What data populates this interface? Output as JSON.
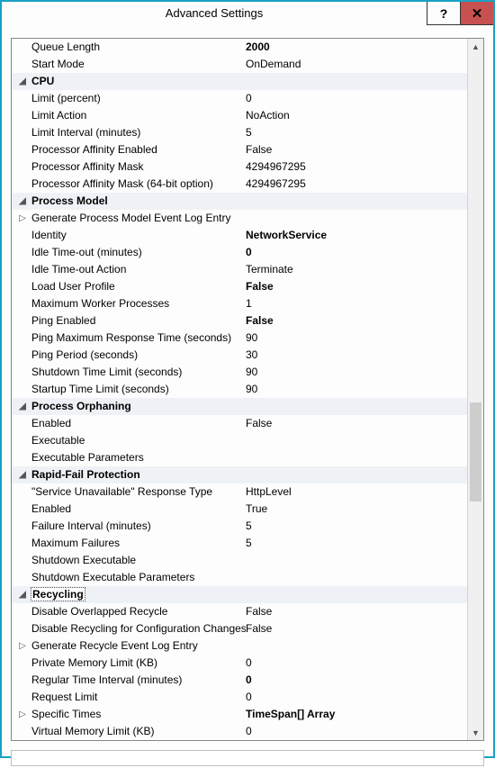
{
  "window": {
    "title": "Advanced Settings"
  },
  "glyph": {
    "expanded": "◢",
    "collapsed": "▷",
    "help": "?",
    "close": "✕",
    "up": "▲",
    "down": "▼"
  },
  "rows": [
    {
      "kind": "prop",
      "label": "Queue Length",
      "value": "2000",
      "boldValue": true
    },
    {
      "kind": "prop",
      "label": "Start Mode",
      "value": "OnDemand"
    },
    {
      "kind": "cat",
      "label": "CPU",
      "expanded": true
    },
    {
      "kind": "prop",
      "label": "Limit (percent)",
      "value": "0"
    },
    {
      "kind": "prop",
      "label": "Limit Action",
      "value": "NoAction"
    },
    {
      "kind": "prop",
      "label": "Limit Interval (minutes)",
      "value": "5"
    },
    {
      "kind": "prop",
      "label": "Processor Affinity Enabled",
      "value": "False"
    },
    {
      "kind": "prop",
      "label": "Processor Affinity Mask",
      "value": "4294967295"
    },
    {
      "kind": "prop",
      "label": "Processor Affinity Mask (64-bit option)",
      "value": "4294967295"
    },
    {
      "kind": "cat",
      "label": "Process Model",
      "expanded": true
    },
    {
      "kind": "sub",
      "label": "Generate Process Model Event Log Entry",
      "value": "",
      "expanded": false
    },
    {
      "kind": "prop",
      "label": "Identity",
      "value": "NetworkService",
      "boldValue": true
    },
    {
      "kind": "prop",
      "label": "Idle Time-out (minutes)",
      "value": "0",
      "boldValue": true
    },
    {
      "kind": "prop",
      "label": "Idle Time-out Action",
      "value": "Terminate"
    },
    {
      "kind": "prop",
      "label": "Load User Profile",
      "value": "False",
      "boldValue": true
    },
    {
      "kind": "prop",
      "label": "Maximum Worker Processes",
      "value": "1"
    },
    {
      "kind": "prop",
      "label": "Ping Enabled",
      "value": "False",
      "boldValue": true
    },
    {
      "kind": "prop",
      "label": "Ping Maximum Response Time (seconds)",
      "value": "90"
    },
    {
      "kind": "prop",
      "label": "Ping Period (seconds)",
      "value": "30"
    },
    {
      "kind": "prop",
      "label": "Shutdown Time Limit (seconds)",
      "value": "90"
    },
    {
      "kind": "prop",
      "label": "Startup Time Limit (seconds)",
      "value": "90"
    },
    {
      "kind": "cat",
      "label": "Process Orphaning",
      "expanded": true
    },
    {
      "kind": "prop",
      "label": "Enabled",
      "value": "False"
    },
    {
      "kind": "prop",
      "label": "Executable",
      "value": ""
    },
    {
      "kind": "prop",
      "label": "Executable Parameters",
      "value": ""
    },
    {
      "kind": "cat",
      "label": "Rapid-Fail Protection",
      "expanded": true
    },
    {
      "kind": "prop",
      "label": "\"Service Unavailable\" Response Type",
      "value": "HttpLevel"
    },
    {
      "kind": "prop",
      "label": "Enabled",
      "value": "True"
    },
    {
      "kind": "prop",
      "label": "Failure Interval (minutes)",
      "value": "5"
    },
    {
      "kind": "prop",
      "label": "Maximum Failures",
      "value": "5"
    },
    {
      "kind": "prop",
      "label": "Shutdown Executable",
      "value": ""
    },
    {
      "kind": "prop",
      "label": "Shutdown Executable Parameters",
      "value": ""
    },
    {
      "kind": "cat",
      "label": "Recycling",
      "expanded": true,
      "selected": true
    },
    {
      "kind": "prop",
      "label": "Disable Overlapped Recycle",
      "value": "False"
    },
    {
      "kind": "prop",
      "label": "Disable Recycling for Configuration Changes",
      "value": "False"
    },
    {
      "kind": "sub",
      "label": "Generate Recycle Event Log Entry",
      "value": "",
      "expanded": false
    },
    {
      "kind": "prop",
      "label": "Private Memory Limit (KB)",
      "value": "0"
    },
    {
      "kind": "prop",
      "label": "Regular Time Interval (minutes)",
      "value": "0",
      "boldValue": true
    },
    {
      "kind": "prop",
      "label": "Request Limit",
      "value": "0"
    },
    {
      "kind": "sub",
      "label": "Specific Times",
      "value": "TimeSpan[] Array",
      "boldValue": true,
      "expanded": false
    },
    {
      "kind": "prop",
      "label": "Virtual Memory Limit (KB)",
      "value": "0"
    }
  ]
}
